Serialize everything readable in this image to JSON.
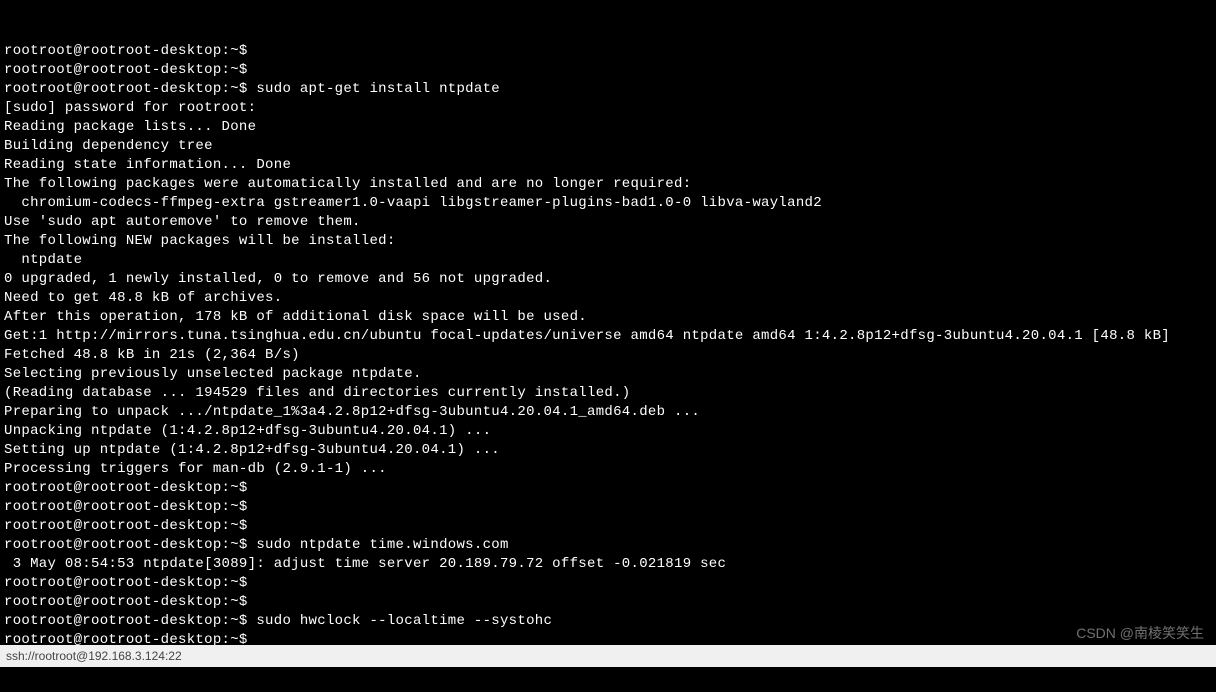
{
  "prompt": "rootroot@rootroot-desktop:~$",
  "lines": [
    "rootroot@rootroot-desktop:~$",
    "rootroot@rootroot-desktop:~$",
    "rootroot@rootroot-desktop:~$ sudo apt-get install ntpdate",
    "[sudo] password for rootroot:",
    "Reading package lists... Done",
    "Building dependency tree",
    "Reading state information... Done",
    "The following packages were automatically installed and are no longer required:",
    "  chromium-codecs-ffmpeg-extra gstreamer1.0-vaapi libgstreamer-plugins-bad1.0-0 libva-wayland2",
    "Use 'sudo apt autoremove' to remove them.",
    "The following NEW packages will be installed:",
    "  ntpdate",
    "0 upgraded, 1 newly installed, 0 to remove and 56 not upgraded.",
    "Need to get 48.8 kB of archives.",
    "After this operation, 178 kB of additional disk space will be used.",
    "Get:1 http://mirrors.tuna.tsinghua.edu.cn/ubuntu focal-updates/universe amd64 ntpdate amd64 1:4.2.8p12+dfsg-3ubuntu4.20.04.1 [48.8 kB]",
    "Fetched 48.8 kB in 21s (2,364 B/s)",
    "Selecting previously unselected package ntpdate.",
    "(Reading database ... 194529 files and directories currently installed.)",
    "Preparing to unpack .../ntpdate_1%3a4.2.8p12+dfsg-3ubuntu4.20.04.1_amd64.deb ...",
    "Unpacking ntpdate (1:4.2.8p12+dfsg-3ubuntu4.20.04.1) ...",
    "Setting up ntpdate (1:4.2.8p12+dfsg-3ubuntu4.20.04.1) ...",
    "Processing triggers for man-db (2.9.1-1) ...",
    "rootroot@rootroot-desktop:~$",
    "rootroot@rootroot-desktop:~$",
    "rootroot@rootroot-desktop:~$",
    "rootroot@rootroot-desktop:~$ sudo ntpdate time.windows.com",
    " 3 May 08:54:53 ntpdate[3089]: adjust time server 20.189.79.72 offset -0.021819 sec",
    "rootroot@rootroot-desktop:~$",
    "rootroot@rootroot-desktop:~$",
    "rootroot@rootroot-desktop:~$ sudo hwclock --localtime --systohc",
    "rootroot@rootroot-desktop:~$"
  ],
  "last_prompt": "rootroot@rootroot-desktop:~$ ",
  "status_bar": "ssh://rootroot@192.168.3.124:22",
  "watermark": "CSDN @南棱笑笑生"
}
